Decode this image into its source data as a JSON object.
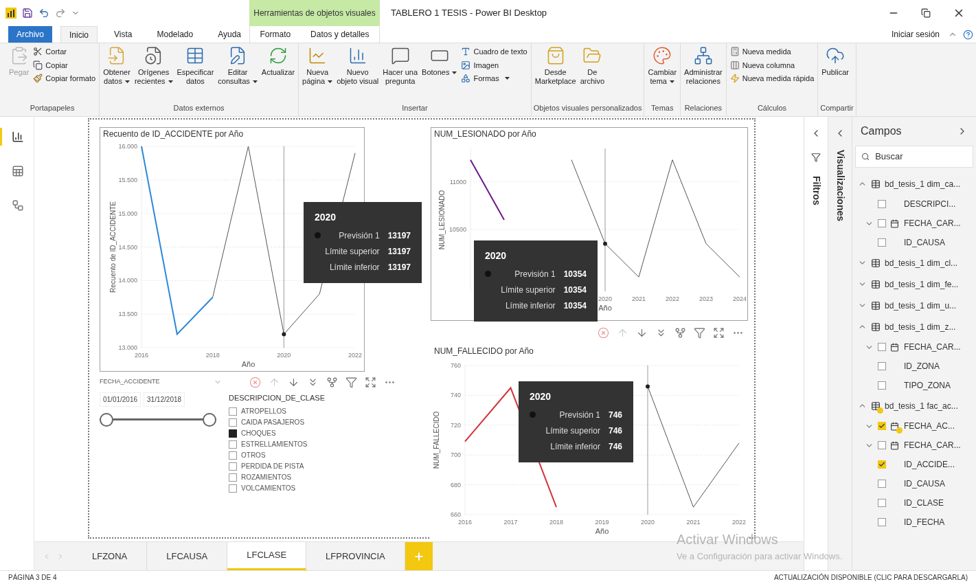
{
  "title_bar": {
    "context_group": "Herramientas de objetos visuales",
    "title": "TABLERO 1 TESIS - Power BI Desktop"
  },
  "menu_tabs": [
    {
      "label": "Archivo",
      "kind": "file",
      "selected": false
    },
    {
      "label": "Inicio",
      "kind": "main",
      "selected": true
    },
    {
      "label": "Vista",
      "kind": "main",
      "selected": false
    },
    {
      "label": "Modelado",
      "kind": "main",
      "selected": false
    },
    {
      "label": "Ayuda",
      "kind": "main",
      "selected": false
    },
    {
      "label": "Formato",
      "kind": "context",
      "selected": false
    },
    {
      "label": "Datos y detalles",
      "kind": "context",
      "selected": false
    }
  ],
  "sign_in": "Iniciar sesión",
  "ribbon": [
    {
      "label": "Portapapeles",
      "buttons": [
        {
          "kind": "large",
          "lines": [
            "Pegar"
          ],
          "dropdown": false,
          "disabled": true
        },
        {
          "kind": "small",
          "lines": [
            "Cortar"
          ],
          "dropdown": false,
          "disabled": false
        },
        {
          "kind": "small",
          "lines": [
            "Copiar"
          ],
          "dropdown": false,
          "disabled": false
        },
        {
          "kind": "small",
          "lines": [
            "Copiar formato"
          ],
          "dropdown": false,
          "disabled": false
        }
      ]
    },
    {
      "label": "Datos externos",
      "buttons": [
        {
          "kind": "large",
          "lines": [
            "Obtener",
            "datos"
          ],
          "dropdown": true,
          "disabled": false
        },
        {
          "kind": "large",
          "lines": [
            "Orígenes",
            "recientes"
          ],
          "dropdown": true,
          "disabled": false
        },
        {
          "kind": "large",
          "lines": [
            "Especificar",
            "datos"
          ],
          "dropdown": false,
          "disabled": false
        },
        {
          "kind": "large",
          "lines": [
            "Editar",
            "consultas"
          ],
          "dropdown": true,
          "disabled": false
        },
        {
          "kind": "large",
          "lines": [
            "Actualizar"
          ],
          "dropdown": false,
          "disabled": false
        }
      ]
    },
    {
      "label": "Insertar",
      "buttons": [
        {
          "kind": "large",
          "lines": [
            "Nueva",
            "página"
          ],
          "dropdown": true,
          "disabled": false
        },
        {
          "kind": "large",
          "lines": [
            "Nuevo",
            "objeto visual"
          ],
          "dropdown": false,
          "disabled": false
        },
        {
          "kind": "large",
          "lines": [
            "Hacer una",
            "pregunta"
          ],
          "dropdown": false,
          "disabled": false
        },
        {
          "kind": "large",
          "lines": [
            "Botones"
          ],
          "dropdown": true,
          "disabled": false
        },
        {
          "kind": "small",
          "lines": [
            "Cuadro de texto"
          ],
          "dropdown": false,
          "disabled": false
        },
        {
          "kind": "small",
          "lines": [
            "Imagen"
          ],
          "dropdown": false,
          "disabled": false
        },
        {
          "kind": "small",
          "lines": [
            "Formas"
          ],
          "dropdown": true,
          "disabled": false
        }
      ]
    },
    {
      "label": "Objetos visuales personalizados",
      "buttons": [
        {
          "kind": "large",
          "lines": [
            "Desde",
            "Marketplace"
          ],
          "dropdown": false,
          "disabled": false
        },
        {
          "kind": "large",
          "lines": [
            "De",
            "archivo"
          ],
          "dropdown": false,
          "disabled": false
        }
      ]
    },
    {
      "label": "Temas",
      "buttons": [
        {
          "kind": "large",
          "lines": [
            "Cambiar",
            "tema"
          ],
          "dropdown": true,
          "disabled": false
        }
      ]
    },
    {
      "label": "Relaciones",
      "buttons": [
        {
          "kind": "large",
          "lines": [
            "Administrar",
            "relaciones"
          ],
          "dropdown": false,
          "disabled": false
        }
      ]
    },
    {
      "label": "Cálculos",
      "buttons": [
        {
          "kind": "small",
          "lines": [
            "Nueva medida"
          ],
          "dropdown": false,
          "disabled": false
        },
        {
          "kind": "small",
          "lines": [
            "Nueva columna"
          ],
          "dropdown": false,
          "disabled": false
        },
        {
          "kind": "small",
          "lines": [
            "Nueva medida rápida"
          ],
          "dropdown": false,
          "disabled": false
        }
      ]
    },
    {
      "label": "Compartir",
      "buttons": [
        {
          "kind": "large",
          "lines": [
            "Publicar"
          ],
          "dropdown": false,
          "disabled": false
        }
      ]
    }
  ],
  "left_nav": [
    {
      "selected": true
    },
    {
      "selected": false
    },
    {
      "selected": false
    }
  ],
  "canvas": {
    "charts": [
      {
        "selected": true,
        "chart_data": {
          "type": "line",
          "title": "Recuento de ID_ACCIDENTE por Año",
          "xlabel": "Año",
          "ylabel": "Recuento de ID_ACCIDENTE",
          "x": [
            2016,
            2017,
            2018,
            2019,
            2020,
            2021,
            2022
          ],
          "series": [
            {
              "color": "#2b88d8",
              "values": [
                16000,
                13200,
                13750,
                null,
                null,
                null,
                null
              ]
            },
            {
              "color": "#555555",
              "values": [
                null,
                null,
                13750,
                16000,
                13200,
                13800,
                15900
              ]
            }
          ],
          "xlim": [
            2016,
            2022
          ],
          "ylim": [
            13000,
            16000
          ],
          "xticks": [
            2016,
            2018,
            2020,
            2022
          ],
          "yticks": [
            {
              "value": 13000,
              "label": "13.000"
            },
            {
              "value": 13500,
              "label": "13.500"
            },
            {
              "value": 14000,
              "label": "14.000"
            },
            {
              "value": 14500,
              "label": "14.500"
            },
            {
              "value": 15000,
              "label": "15.000"
            },
            {
              "value": 15500,
              "label": "15.500"
            },
            {
              "value": 16000,
              "label": "16.000"
            }
          ],
          "grid": true,
          "ref_lines": [
            {
              "axis": "x",
              "value": 2020
            }
          ]
        },
        "tooltip": {
          "year": "2020",
          "rows": [
            {
              "kind": "series",
              "label": "Previsión 1",
              "value": "13197"
            },
            {
              "kind": "bound",
              "label": "Límite superior",
              "value": "13197"
            },
            {
              "kind": "bound",
              "label": "Límite inferior",
              "value": "13197"
            }
          ]
        }
      },
      {
        "selected": true,
        "chart_data": {
          "type": "line",
          "title": "NUM_LESIONADO por Año",
          "xlabel": "Año",
          "ylabel": "NUM_LESIONADO",
          "x": [
            2016,
            2017,
            2018,
            2019,
            2020,
            2021,
            2022,
            2023,
            2024
          ],
          "series": [
            {
              "color": "#6b1a8c",
              "values": [
                11230,
                10600,
                null,
                null,
                null,
                null,
                null,
                null,
                null
              ]
            },
            {
              "color": "#555555",
              "values": [
                null,
                null,
                null,
                11230,
                10350,
                10000,
                11230,
                10350,
                10000
              ]
            }
          ],
          "xlim": [
            2016,
            2024
          ],
          "ylim": [
            9850,
            11350
          ],
          "xticks": [
            2020,
            2021,
            2022,
            2023,
            2024
          ],
          "yticks": [
            10500,
            11000
          ],
          "grid": true,
          "ref_lines": [
            {
              "axis": "x",
              "value": 2020
            }
          ]
        },
        "tooltip": {
          "year": "2020",
          "rows": [
            {
              "kind": "series",
              "label": "Previsión 1",
              "value": "10354"
            },
            {
              "kind": "bound",
              "label": "Límite superior",
              "value": "10354"
            },
            {
              "kind": "bound",
              "label": "Límite inferior",
              "value": "10354"
            }
          ]
        }
      },
      {
        "selected": false,
        "chart_data": {
          "type": "line",
          "title": "NUM_FALLECIDO por Año",
          "xlabel": "Año",
          "ylabel": "NUM_FALLECIDO",
          "x": [
            2016,
            2017,
            2018,
            2019,
            2020,
            2021,
            2022
          ],
          "series": [
            {
              "color": "#d13438",
              "values": [
                709,
                745,
                665,
                null,
                null,
                null,
                null
              ]
            },
            {
              "color": "#555555",
              "values": [
                null,
                null,
                null,
                null,
                746,
                665,
                708
              ]
            }
          ],
          "xlim": [
            2016,
            2022
          ],
          "ylim": [
            660,
            760
          ],
          "xticks": [
            2016,
            2017,
            2018,
            2019,
            2020,
            2021,
            2022
          ],
          "yticks": [
            660,
            680,
            700,
            720,
            740,
            760
          ],
          "grid": true,
          "ref_lines": [
            {
              "axis": "x",
              "value": 2020
            }
          ]
        },
        "tooltip": {
          "year": "2020",
          "rows": [
            {
              "kind": "series",
              "label": "Previsión 1",
              "value": "746"
            },
            {
              "kind": "bound",
              "label": "Límite superior",
              "value": "746"
            },
            {
              "kind": "bound",
              "label": "Límite inferior",
              "value": "746"
            }
          ]
        }
      }
    ],
    "date_slicer": {
      "title": "FECHA_ACCIDENTE",
      "start": "01/01/2016",
      "end": "31/12/2018",
      "level": 1
    },
    "list_slicer": {
      "title": "DESCRIPCION_DE_CLASE",
      "items": [
        {
          "label": "ATROPELLOS",
          "checked": false
        },
        {
          "label": "CAIDA PASAJEROS",
          "checked": false
        },
        {
          "label": "CHOQUES",
          "checked": true
        },
        {
          "label": "ESTRELLAMIENTOS",
          "checked": false
        },
        {
          "label": "OTROS",
          "checked": false
        },
        {
          "label": "PERDIDA DE PISTA",
          "checked": false
        },
        {
          "label": "ROZAMIENTOS",
          "checked": false
        },
        {
          "label": "VOLCAMIENTOS",
          "checked": false
        }
      ]
    }
  },
  "panes": {
    "filters": "Filtros",
    "visualizations": "Visualizaciones",
    "fields": {
      "title": "Campos",
      "search_placeholder": "Buscar",
      "tables": [
        {
          "label": "bd_tesis_1 dim_ca...",
          "expanded": true,
          "in_use": false,
          "children": [
            {
              "label": "DESCRIPCI...",
              "kind": "field",
              "checked": false
            },
            {
              "label": "FECHA_CAR...",
              "kind": "date",
              "checked": false,
              "in_use": false
            },
            {
              "label": "ID_CAUSA",
              "kind": "field",
              "checked": false
            }
          ]
        },
        {
          "label": "bd_tesis_1 dim_cl...",
          "expanded": false,
          "in_use": false
        },
        {
          "label": "bd_tesis_1 dim_fe...",
          "expanded": false,
          "in_use": false
        },
        {
          "label": "bd_tesis_1 dim_u...",
          "expanded": false,
          "in_use": false
        },
        {
          "label": "bd_tesis_1 dim_z...",
          "expanded": true,
          "in_use": false,
          "children": [
            {
              "label": "FECHA_CAR...",
              "kind": "date",
              "checked": false,
              "in_use": false
            },
            {
              "label": "ID_ZONA",
              "kind": "field",
              "checked": false
            },
            {
              "label": "TIPO_ZONA",
              "kind": "field",
              "checked": false
            }
          ]
        },
        {
          "label": "bd_tesis_1 fac_ac...",
          "expanded": true,
          "in_use": true,
          "children": [
            {
              "label": "FECHA_AC...",
              "kind": "date",
              "checked": true,
              "in_use": true
            },
            {
              "label": "FECHA_CAR...",
              "kind": "date",
              "checked": false,
              "in_use": false
            },
            {
              "label": "ID_ACCIDE...",
              "kind": "field",
              "checked": true
            },
            {
              "label": "ID_CAUSA",
              "kind": "field",
              "checked": false
            },
            {
              "label": "ID_CLASE",
              "kind": "field",
              "checked": false
            },
            {
              "label": "ID_FECHA",
              "kind": "field",
              "checked": false
            }
          ]
        }
      ]
    }
  },
  "page_tabs": [
    {
      "label": "LFZONA",
      "selected": false
    },
    {
      "label": "LFCAUSA",
      "selected": false
    },
    {
      "label": "LFCLASE",
      "selected": true
    },
    {
      "label": "LFPROVINCIA",
      "selected": false
    }
  ],
  "activation_notice": {
    "title": "Activar Windows",
    "text": "Ve a Configuración para activar Windows."
  },
  "status_bar": {
    "page": "PÁGINA 3 DE 4",
    "update": "ACTUALIZACIÓN DISPONIBLE (CLIC PARA DESCARGARLA)"
  }
}
